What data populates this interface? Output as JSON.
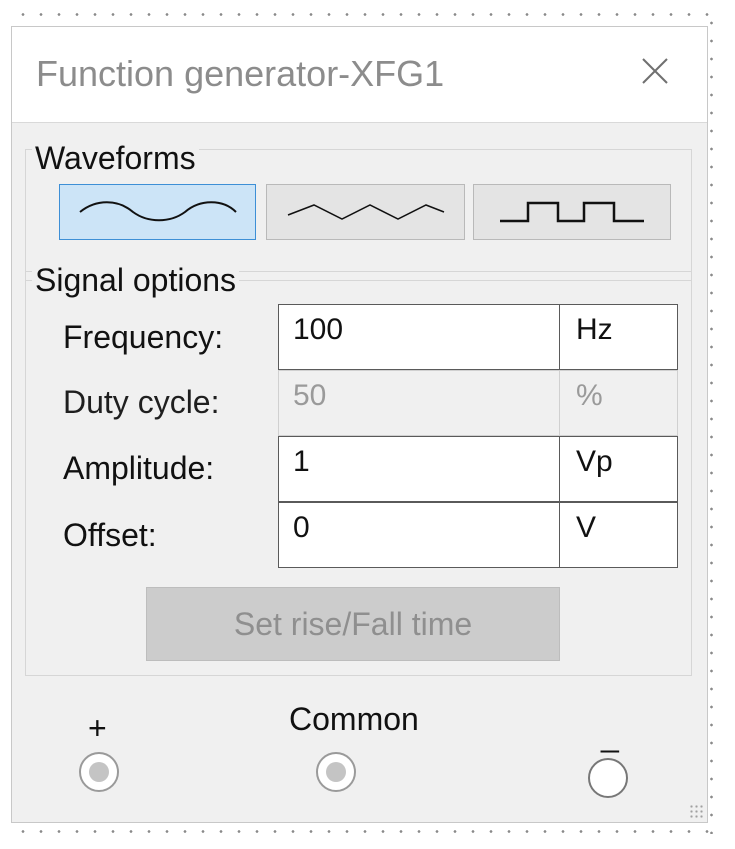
{
  "window": {
    "title": "Function generator-XFG1"
  },
  "waveforms": {
    "label": "Waveforms",
    "buttons": [
      {
        "name": "sine-wave",
        "icon": "sine-wave-icon",
        "selected": true
      },
      {
        "name": "triangle-wave",
        "icon": "triangle-wave-icon",
        "selected": false
      },
      {
        "name": "square-wave",
        "icon": "square-wave-icon",
        "selected": false
      }
    ]
  },
  "signal_options": {
    "label": "Signal options",
    "rows": [
      {
        "label": "Frequency:",
        "value": "100",
        "unit": "Hz",
        "enabled": true
      },
      {
        "label": "Duty cycle:",
        "value": "50",
        "unit": "%",
        "enabled": false
      },
      {
        "label": "Amplitude:",
        "value": "1",
        "unit": "Vp",
        "enabled": true
      },
      {
        "label": "Offset:",
        "value": "0",
        "unit": "V",
        "enabled": true
      }
    ],
    "rise_fall_button": "Set rise/Fall time"
  },
  "terminals": {
    "plus": "+",
    "common": "Common",
    "minus": "_"
  },
  "colors": {
    "selected_button_bg": "#cce4f7",
    "selected_button_border": "#3d8fd6",
    "disabled_text": "#9a9a9a"
  }
}
